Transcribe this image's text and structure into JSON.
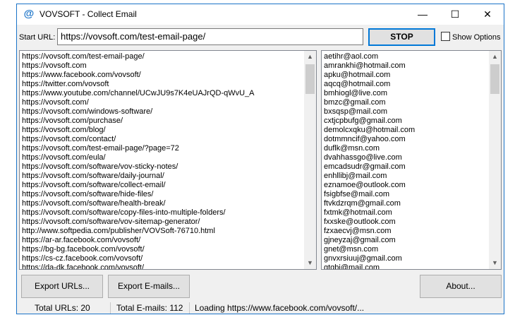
{
  "window": {
    "title": "VOVSOFT - Collect Email",
    "icon": "at-icon",
    "controls": {
      "minimize": "—",
      "maximize": "☐",
      "close": "✕"
    }
  },
  "toolbar": {
    "url_label": "Start URL:",
    "url_value": "https://vovsoft.com/test-email-page/",
    "stop_label": "STOP",
    "show_options_label": "Show Options"
  },
  "url_list": [
    "https://vovsoft.com/test-email-page/",
    "https://vovsoft.com",
    "https://www.facebook.com/vovsoft/",
    "https://twitter.com/vovsoft",
    "https://www.youtube.com/channel/UCwJU9s7K4eUAJrQD-qWvU_A",
    "https://vovsoft.com/",
    "https://vovsoft.com/windows-software/",
    "https://vovsoft.com/purchase/",
    "https://vovsoft.com/blog/",
    "https://vovsoft.com/contact/",
    "https://vovsoft.com/test-email-page/?page=72",
    "https://vovsoft.com/eula/",
    "https://vovsoft.com/software/vov-sticky-notes/",
    "https://vovsoft.com/software/daily-journal/",
    "https://vovsoft.com/software/collect-email/",
    "https://vovsoft.com/software/hide-files/",
    "https://vovsoft.com/software/health-break/",
    "https://vovsoft.com/software/copy-files-into-multiple-folders/",
    "https://vovsoft.com/software/vov-sitemap-generator/",
    "http://www.softpedia.com/publisher/VOVSoft-76710.html",
    "https://ar-ar.facebook.com/vovsoft/",
    "https://bg-bg.facebook.com/vovsoft/",
    "https://cs-cz.facebook.com/vovsoft/",
    "https://da-dk.facebook.com/vovsoft/"
  ],
  "email_list": [
    "aetihr@aol.com",
    "amrankhi@hotmail.com",
    "apku@hotmail.com",
    "aqcq@hotmail.com",
    "bmhiogl@live.com",
    "bmzc@gmail.com",
    "bxsqsp@mail.com",
    "cxtjcpbufg@gmail.com",
    "demolcxqku@hotmail.com",
    "dotmmncif@yahoo.com",
    "duflk@msn.com",
    "dvahhassgo@live.com",
    "emcadsudr@gmail.com",
    "enhllibj@mail.com",
    "eznamoe@outlook.com",
    "fsigbfse@mail.com",
    "ftvkdzrqm@gmail.com",
    "fxtmk@hotmail.com",
    "fxxske@outlook.com",
    "fzxaecvj@msn.com",
    "gjneyzaj@gmail.com",
    "gnet@msn.com",
    "gnvxrsiuuj@gmail.com",
    "gtqbi@mail.com"
  ],
  "buttons": {
    "export_urls": "Export URLs...",
    "export_emails": "Export E-mails...",
    "about": "About..."
  },
  "status": {
    "total_urls": "Total URLs: 20",
    "total_emails": "Total E-mails: 112",
    "loading": "Loading https://www.facebook.com/vovsoft/..."
  }
}
